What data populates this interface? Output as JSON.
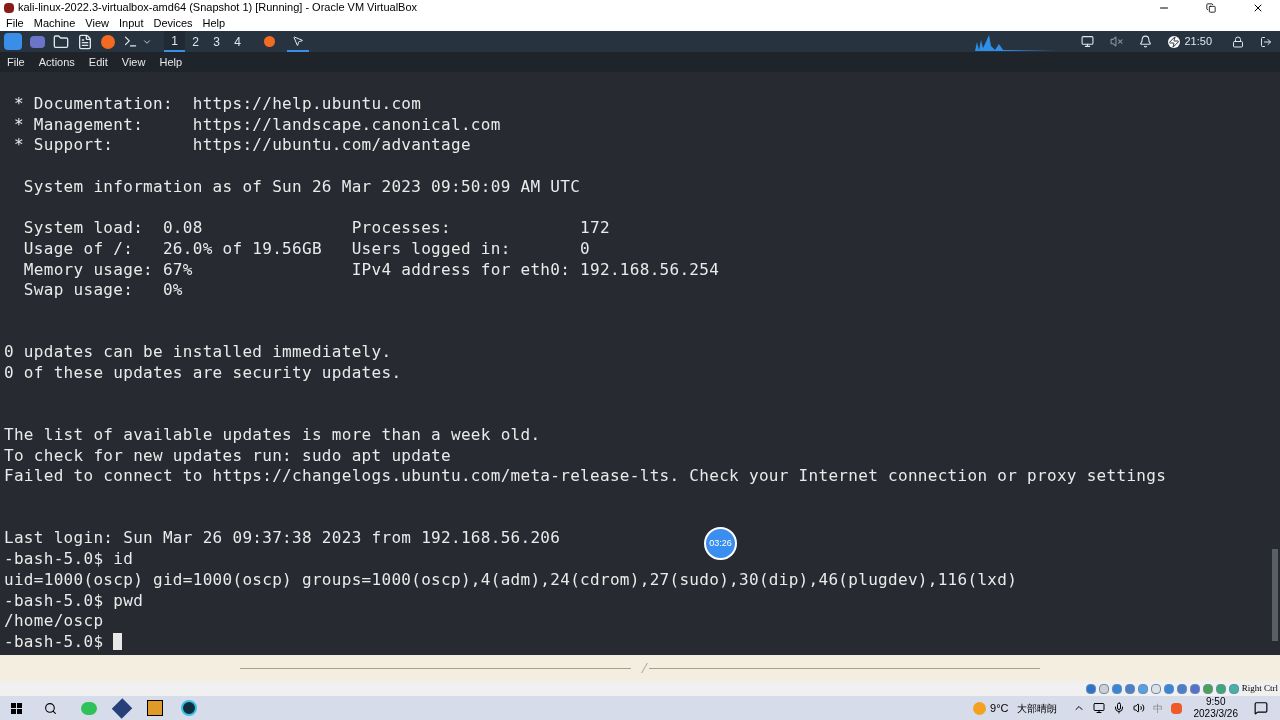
{
  "window": {
    "title": "kali-linux-2022.3-virtualbox-amd64 (Snapshot 1) [Running] - Oracle VM VirtualBox"
  },
  "vbox_menu": [
    "File",
    "Machine",
    "View",
    "Input",
    "Devices",
    "Help"
  ],
  "kali_panel": {
    "workspaces": [
      {
        "label": "1",
        "selected": true
      },
      {
        "label": "2",
        "selected": false
      },
      {
        "label": "3",
        "selected": false
      },
      {
        "label": "4",
        "selected": false
      }
    ],
    "clock": "21:50"
  },
  "terminal": {
    "menu": [
      "File",
      "Actions",
      "Edit",
      "View",
      "Help"
    ],
    "lines": [
      {
        "kind": "blank"
      },
      {
        "kind": "text",
        "text": " * Documentation:  https://help.ubuntu.com"
      },
      {
        "kind": "text",
        "text": " * Management:     https://landscape.canonical.com"
      },
      {
        "kind": "text",
        "text": " * Support:        https://ubuntu.com/advantage"
      },
      {
        "kind": "blank"
      },
      {
        "kind": "text",
        "text": "  System information as of Sun 26 Mar 2023 09:50:09 AM UTC"
      },
      {
        "kind": "blank"
      },
      {
        "kind": "text",
        "text": "  System load:  0.08               Processes:             172"
      },
      {
        "kind": "text",
        "text": "  Usage of /:   26.0% of 19.56GB   Users logged in:       0"
      },
      {
        "kind": "text",
        "text": "  Memory usage: 67%                IPv4 address for eth0: 192.168.56.254"
      },
      {
        "kind": "text",
        "text": "  Swap usage:   0%"
      },
      {
        "kind": "blank"
      },
      {
        "kind": "blank"
      },
      {
        "kind": "text",
        "text": "0 updates can be installed immediately."
      },
      {
        "kind": "text",
        "text": "0 of these updates are security updates."
      },
      {
        "kind": "blank"
      },
      {
        "kind": "blank"
      },
      {
        "kind": "text",
        "text": "The list of available updates is more than a week old."
      },
      {
        "kind": "text",
        "text": "To check for new updates run: sudo apt update"
      },
      {
        "kind": "text",
        "text": "Failed to connect to https://changelogs.ubuntu.com/meta-release-lts. Check your Internet connection or proxy settings"
      },
      {
        "kind": "blank"
      },
      {
        "kind": "blank"
      },
      {
        "kind": "text",
        "text": "Last login: Sun Mar 26 09:37:38 2023 from 192.168.56.206"
      },
      {
        "kind": "text",
        "text": "-bash-5.0$ id"
      },
      {
        "kind": "text",
        "text": "uid=1000(oscp) gid=1000(oscp) groups=1000(oscp),4(adm),24(cdrom),27(sudo),30(dip),46(plugdev),116(lxd)"
      },
      {
        "kind": "text",
        "text": "-bash-5.0$ pwd"
      },
      {
        "kind": "text",
        "text": "/home/oscp"
      },
      {
        "kind": "prompt",
        "text": "-bash-5.0$ "
      }
    ]
  },
  "timer": "03:26",
  "vbox_status": {
    "host_key": "Right Ctrl"
  },
  "taskbar": {
    "weather": "9°C",
    "weather_text": "大部晴朗",
    "ime": "中",
    "time": "9:50",
    "date": "2023/3/26"
  }
}
